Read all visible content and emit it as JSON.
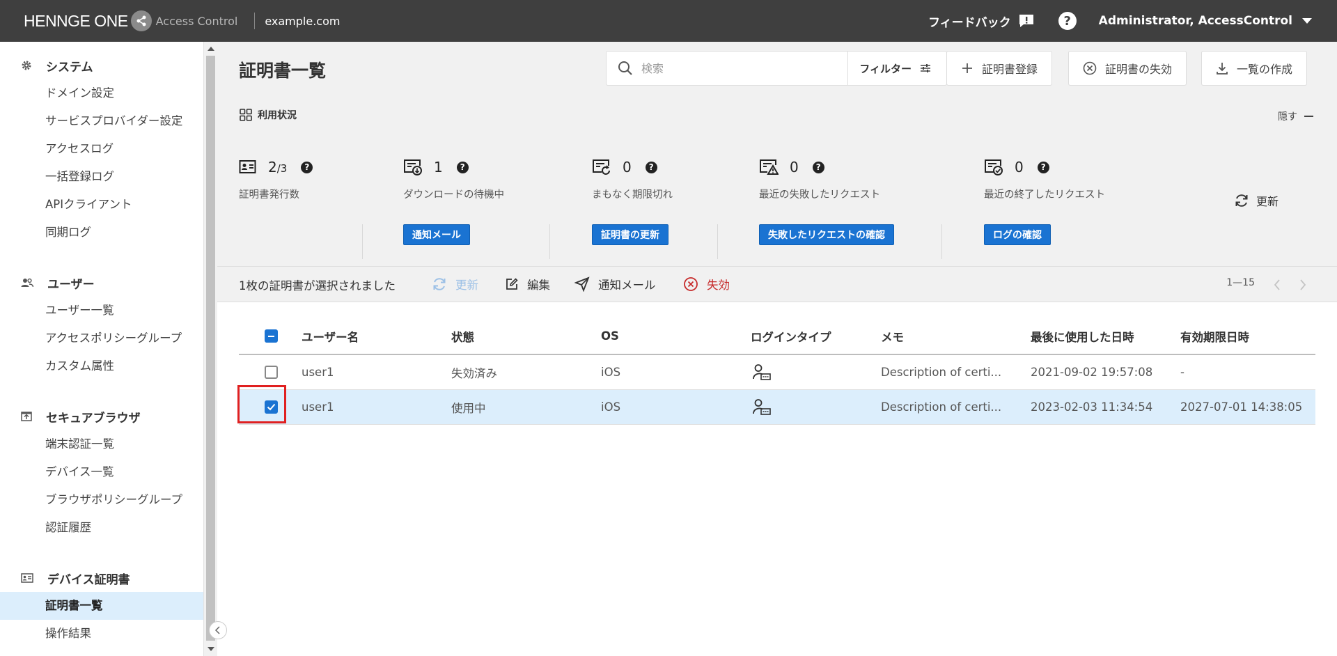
{
  "topbar": {
    "brand": "HENNGE ONE",
    "product": "Access Control",
    "domain": "example.com",
    "feedback": "フィードバック",
    "help": "?",
    "user": "Administrator, AccessControl"
  },
  "sidebar": {
    "sections": [
      {
        "title": "システム",
        "icon": "gear-icon",
        "items": [
          "ドメイン設定",
          "サービスプロバイダー設定",
          "アクセスログ",
          "一括登録ログ",
          "APIクライアント",
          "同期ログ"
        ]
      },
      {
        "title": "ユーザー",
        "icon": "users-icon",
        "items": [
          "ユーザー一覧",
          "アクセスポリシーグループ",
          "カスタム属性"
        ]
      },
      {
        "title": "セキュアブラウザ",
        "icon": "upload-box-icon",
        "items": [
          "端末認証一覧",
          "デバイス一覧",
          "ブラウザポリシーグループ",
          "認証履歴"
        ]
      },
      {
        "title": "デバイス証明書",
        "icon": "id-card-icon",
        "items": [
          "証明書一覧",
          "操作結果"
        ]
      }
    ],
    "active_item": "証明書一覧"
  },
  "page": {
    "title": "証明書一覧",
    "search_placeholder": "検索",
    "filter_label": "フィルター",
    "register_label": "証明書登録",
    "revoke_label": "証明書の失効",
    "export_label": "一覧の作成"
  },
  "usage": {
    "title": "利用状況",
    "hide_label": "隠す",
    "refresh_label": "更新",
    "stats": [
      {
        "value": "2",
        "total": "/3",
        "label": "証明書発行数",
        "button": ""
      },
      {
        "value": "1",
        "total": "",
        "label": "ダウンロードの待機中",
        "button": "通知メール"
      },
      {
        "value": "0",
        "total": "",
        "label": "まもなく期限切れ",
        "button": "証明書の更新"
      },
      {
        "value": "0",
        "total": "",
        "label": "最近の失敗したリクエスト",
        "button": "失敗したリクエストの確認"
      },
      {
        "value": "0",
        "total": "",
        "label": "最近の終了したリクエスト",
        "button": "ログの確認"
      }
    ]
  },
  "actions": {
    "selected_text": "1枚の証明書が選択されました",
    "refresh": "更新",
    "edit": "編集",
    "notify": "通知メール",
    "revoke": "失効",
    "range": "1—15"
  },
  "table": {
    "headers": [
      "ユーザー名",
      "状態",
      "OS",
      "ログインタイプ",
      "メモ",
      "最後に使用した日時",
      "有効期限日時"
    ],
    "rows": [
      {
        "checked": false,
        "user": "user1",
        "status": "失効済み",
        "os": "iOS",
        "login_type": "user-certificate-icon",
        "memo": "Description of certi...",
        "last_used": "2021-09-02 19:57:08",
        "expires": "-"
      },
      {
        "checked": true,
        "user": "user1",
        "status": "使用中",
        "os": "iOS",
        "login_type": "user-certificate-icon",
        "memo": "Description of certi...",
        "last_used": "2023-02-03 11:34:54",
        "expires": "2027-07-01 14:38:05"
      }
    ]
  },
  "colors": {
    "accent": "#1a73d2",
    "topbar": "#3f3f3f",
    "selected_row": "#dceefc",
    "danger": "#c62828",
    "highlight": "#e02020"
  }
}
